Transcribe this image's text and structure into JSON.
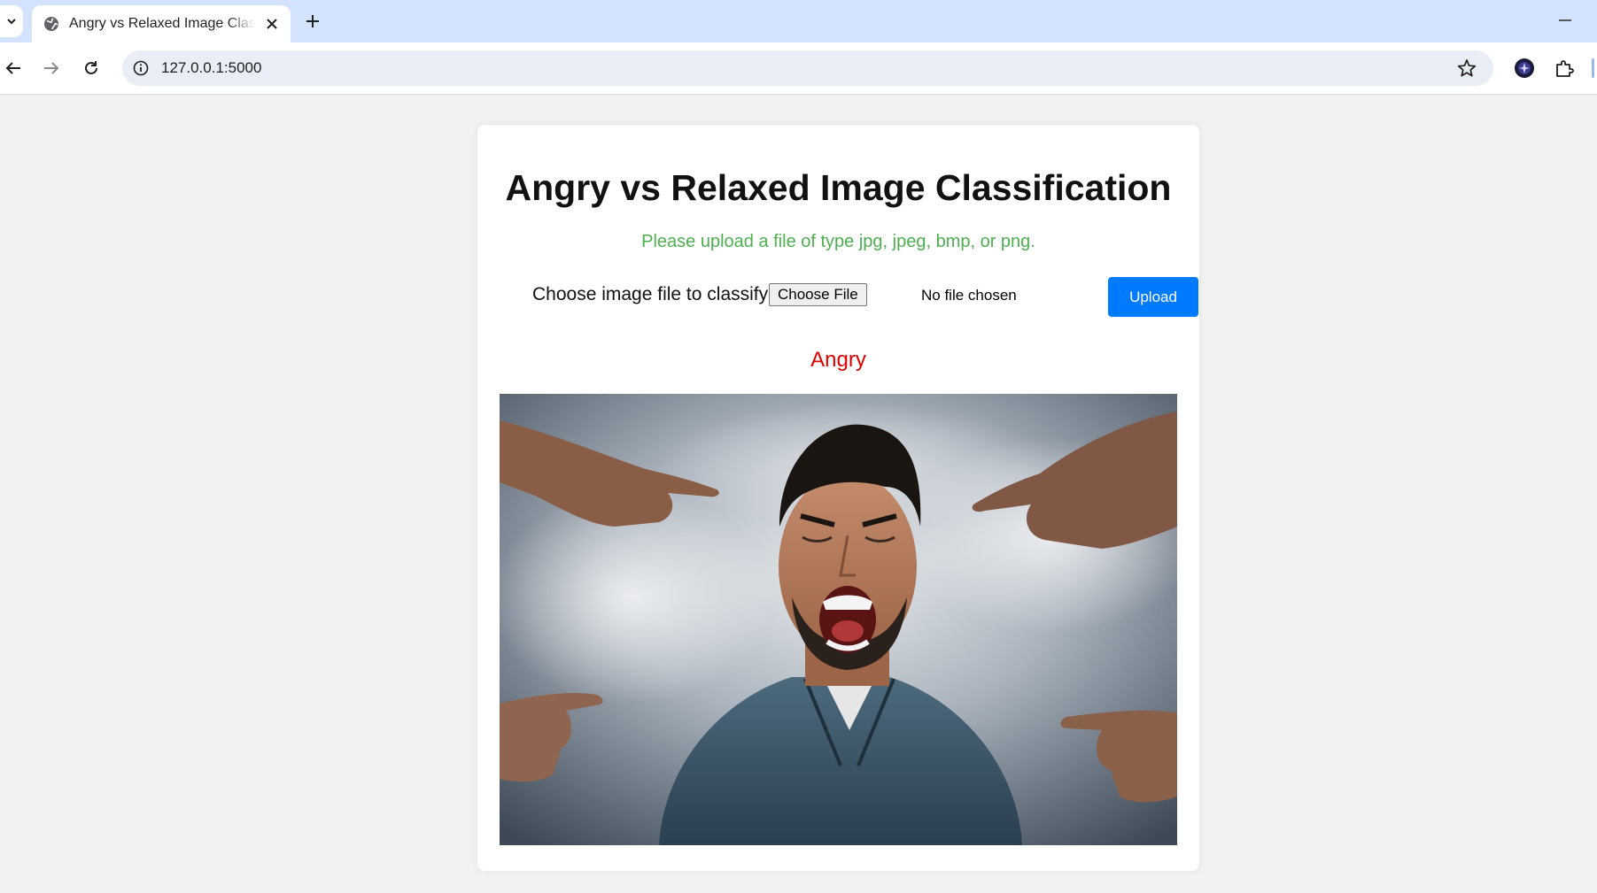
{
  "browser": {
    "tab_title": "Angry vs Relaxed Image Classification",
    "url": "127.0.0.1:5000"
  },
  "page": {
    "heading": "Angry vs Relaxed Image Classification",
    "hint": "Please upload a file of type jpg, jpeg, bmp, or png.",
    "form": {
      "label": "Choose image file to classify:",
      "choose_file_label": "Choose File",
      "file_status": "No file chosen",
      "upload_label": "Upload"
    },
    "result": {
      "label": "Angry",
      "color": "#e00000"
    },
    "image": {
      "subject": "man screaming in smoke surrounded by pointing hands"
    }
  },
  "colors": {
    "tabbar": "#d3e3fd",
    "hint": "#4caf50",
    "upload_button": "#007bff",
    "page_background": "#f2f2f2"
  }
}
